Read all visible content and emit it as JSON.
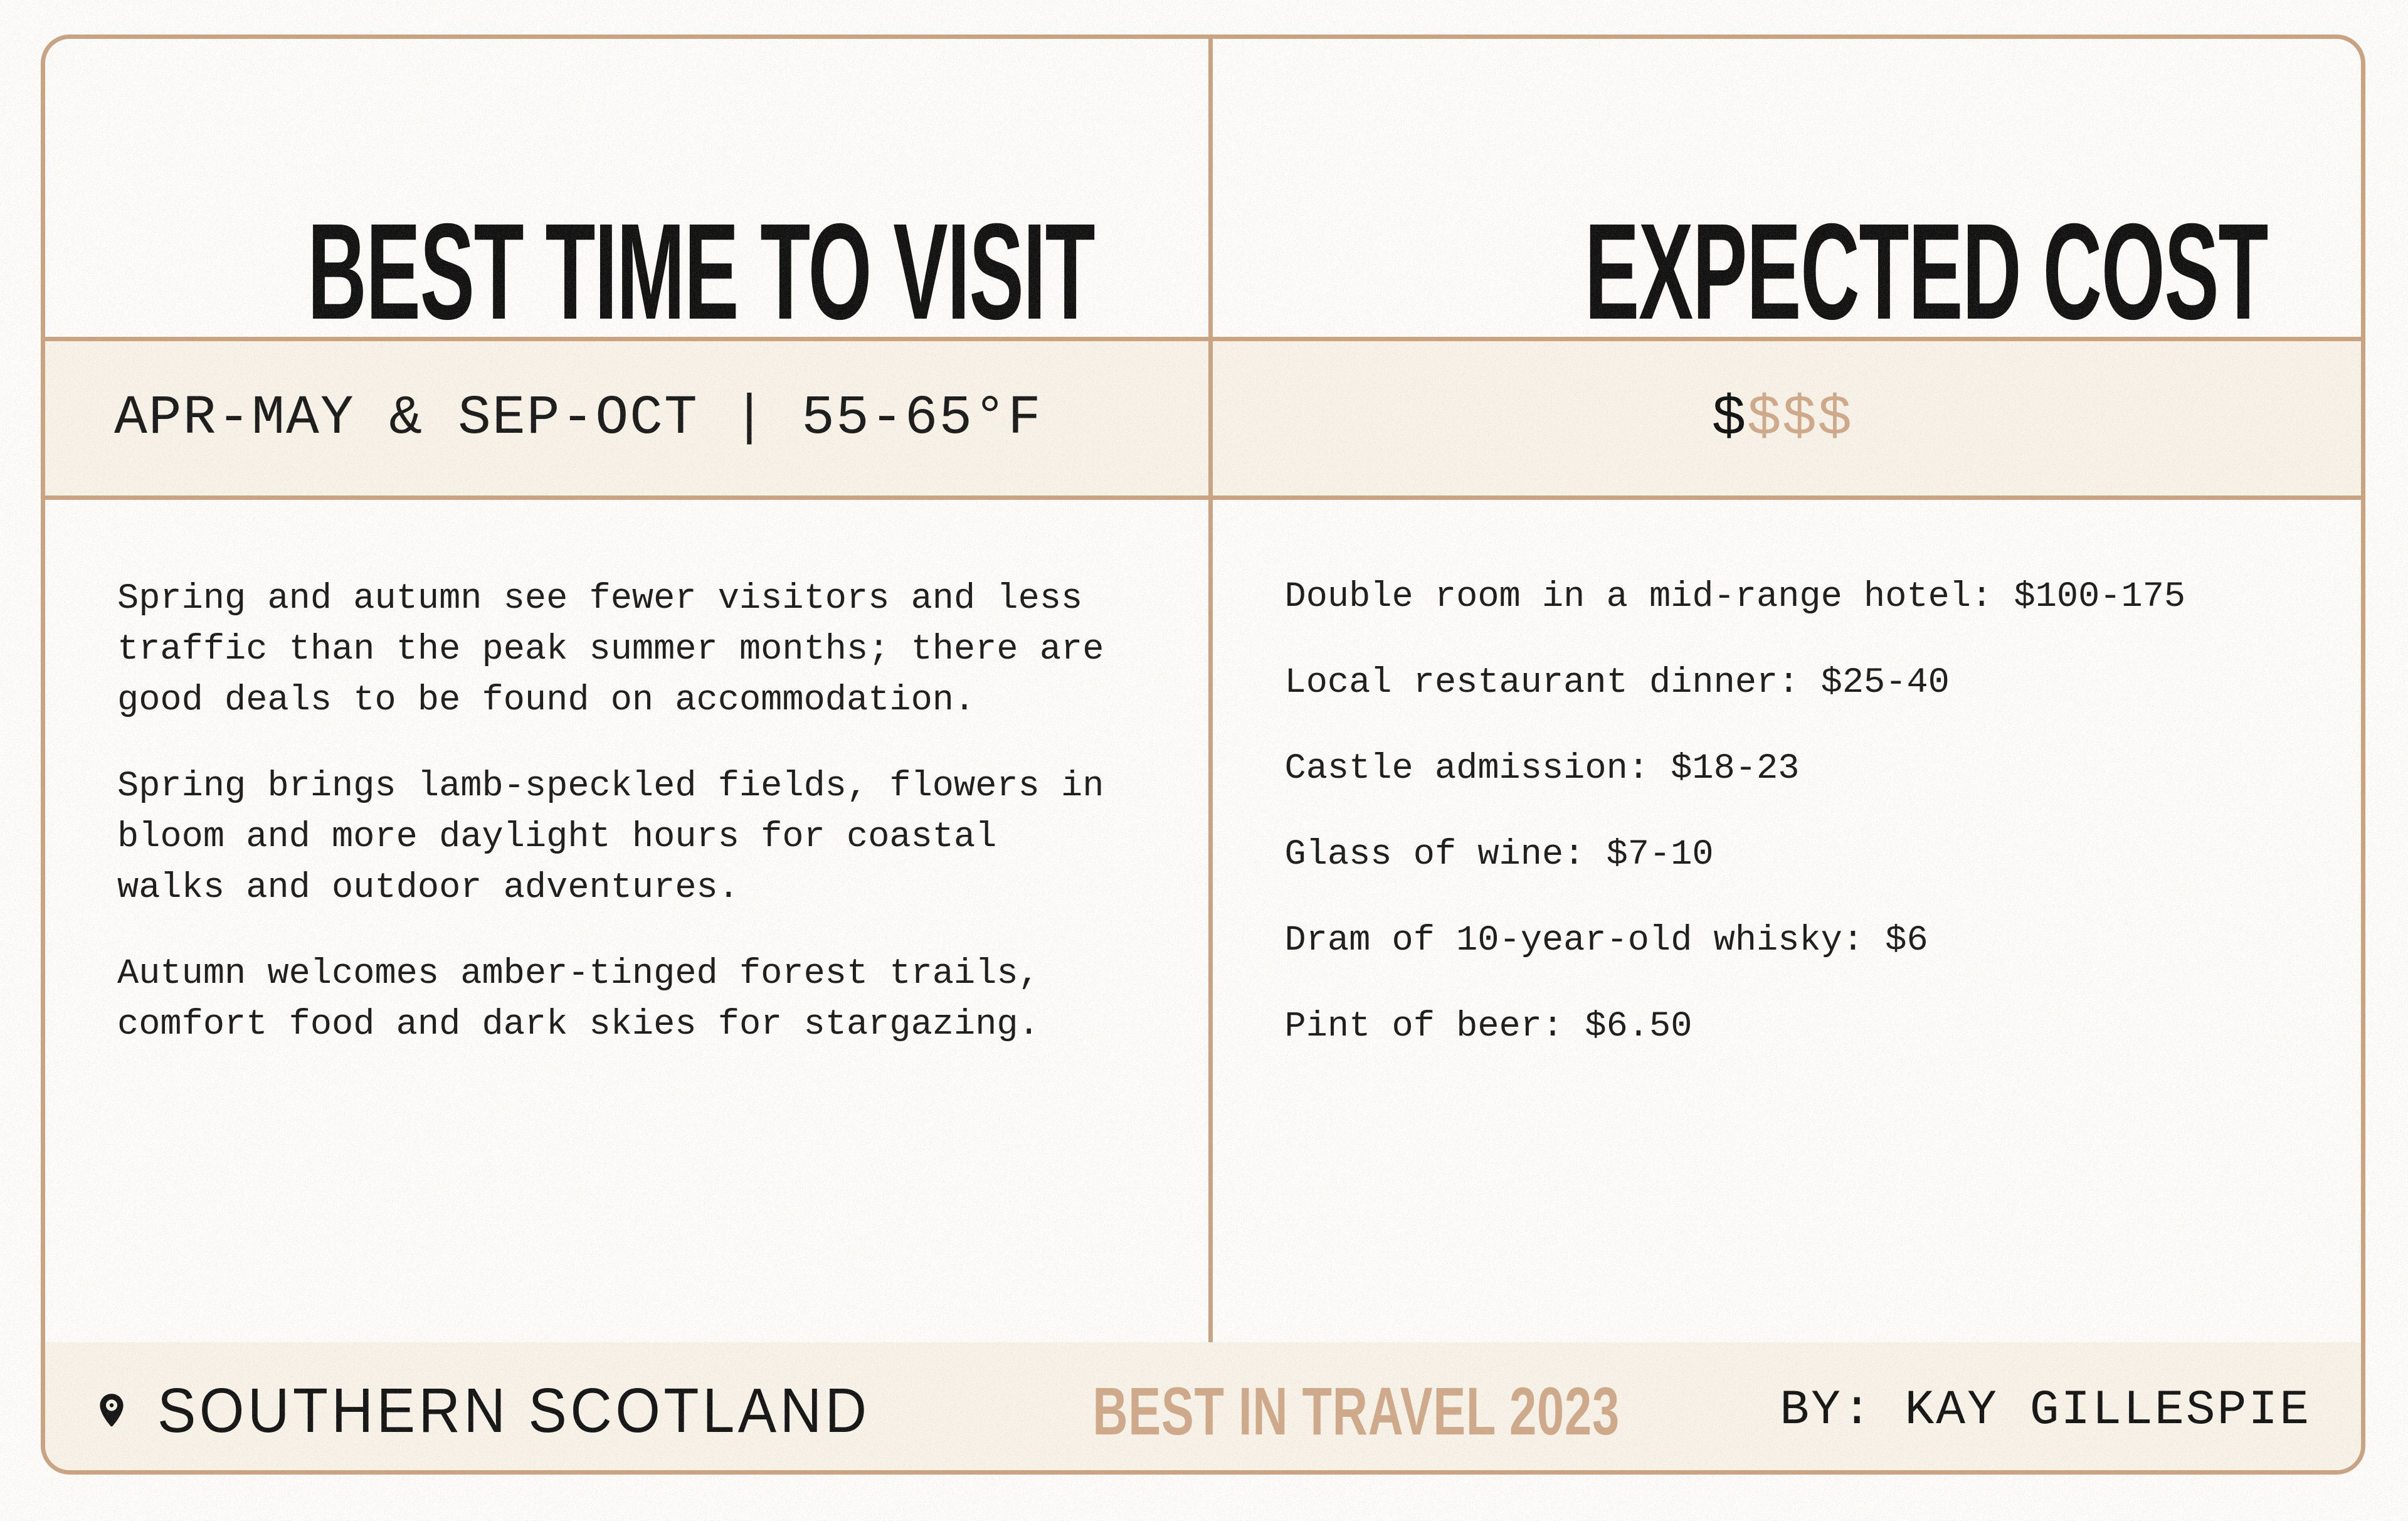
{
  "colors": {
    "border": "#c9a382",
    "band_bg": "#f8f3e8",
    "page_bg": "#fdfcfa",
    "accent_tan": "#cfa98a",
    "text": "#1b1b1b"
  },
  "columns": {
    "left": {
      "heading": "BEST TIME TO VISIT",
      "band_text": "APR-MAY & SEP-OCT | 55-65°F",
      "paragraphs": [
        "Spring and autumn see fewer visitors and less traffic than the peak summer months; there are good deals to be found on accommodation.",
        "Spring brings lamb-speckled fields, flowers in bloom and more daylight hours for coastal walks and outdoor adventures.",
        "Autumn welcomes amber-tinged forest trails, comfort food and dark skies for stargazing."
      ]
    },
    "right": {
      "heading": "EXPECTED COST",
      "cost_level_filled": "$",
      "cost_level_empty": "$$$",
      "items": [
        "Double room in a mid-range hotel: $100-175",
        "Local restaurant dinner: $25-40",
        "Castle admission: $18-23",
        "Glass of wine: $7-10",
        "Dram of 10-year-old whisky: $6",
        "Pint of beer: $6.50"
      ]
    }
  },
  "footer": {
    "location_icon": "location-pin-icon",
    "location": "SOUTHERN SCOTLAND",
    "brand": "BEST IN TRAVEL 2023",
    "byline": "BY: KAY GILLESPIE"
  }
}
